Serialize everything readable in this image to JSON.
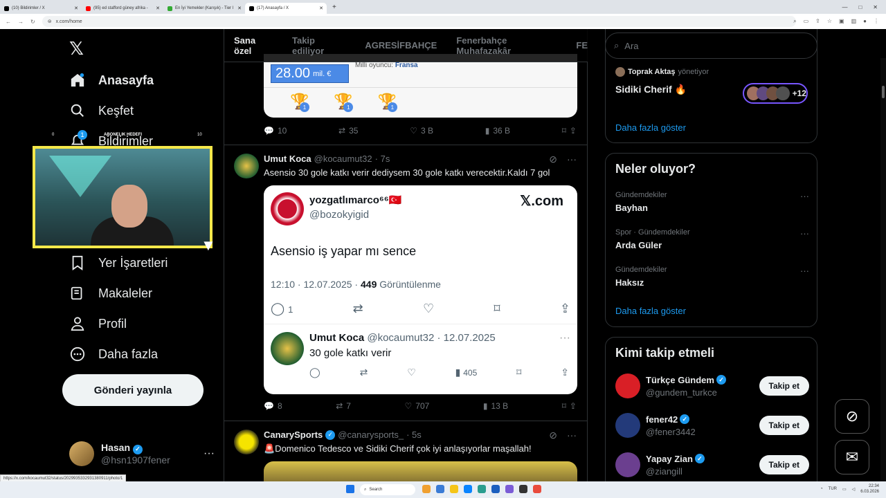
{
  "browser": {
    "tabs": [
      {
        "label": "(10) Bildirimler / X",
        "active": false
      },
      {
        "label": "(95) ed stafford güney afrika - ",
        "active": false
      },
      {
        "label": "En İyi Yemekler (Karışık) - Tier l",
        "active": false
      },
      {
        "label": "(17) Anasayfa / X",
        "active": true
      }
    ],
    "url": "x.com/home",
    "status_url": "https://x.com/kocaumut32/status/2029935332931380911/photo/1"
  },
  "nav": {
    "items": [
      {
        "label": "Anasayfa",
        "icon": "home-icon"
      },
      {
        "label": "Keşfet",
        "icon": "search-icon"
      },
      {
        "label": "Bildirimler",
        "icon": "bell-icon",
        "badge": "1"
      },
      {
        "label": "Yer İşaretleri",
        "icon": "bookmark-icon"
      },
      {
        "label": "Makaleler",
        "icon": "article-icon"
      },
      {
        "label": "Profil",
        "icon": "person-icon"
      },
      {
        "label": "Daha fazla",
        "icon": "more-circle-icon"
      }
    ],
    "post_button": "Gönderi yayınla",
    "account": {
      "name": "Hasan",
      "handle": "@hsn1907fener"
    }
  },
  "overlay": {
    "title": "ABONELIK HEDEFI",
    "left_num": "0",
    "right_num": "10"
  },
  "feed": {
    "tabs": [
      "Sana özel",
      "Takip ediliyor",
      "AGRESİFBAHÇE",
      "Fenerbahçe Muhafazakâr",
      "FE"
    ],
    "card_top": {
      "price": "28.00",
      "price_unit": "mil. €",
      "national_label": "Milli oyuncu:",
      "national_value": "Fransa",
      "trophy_counts": [
        "1",
        "1",
        "1"
      ]
    },
    "post0_actions": {
      "reply": "10",
      "repost": "35",
      "like": "3 B",
      "views": "36 B"
    },
    "post1": {
      "name": "Umut Koca",
      "handle": "@kocaumut32",
      "time": "· 7s",
      "text": "Asensio 30 gole katkı verir dediysem 30 gole katkı verecektir.Kaldı 7 gol",
      "embed": {
        "name": "yozgatlımarco⁶⁶🇹🇷",
        "handle": "@bozokyigid",
        "brand": "𝕏.com",
        "text": "Asensio iş yapar mı sence",
        "time": "12:10 · 12.07.2025 ·",
        "views_num": "449",
        "views_label": "Görüntülenme",
        "reply_count": "1",
        "reply": {
          "name": "Umut Koca",
          "handle": "@kocaumut32 · 12.07.2025",
          "text": "30 gole katkı verir",
          "views": "405"
        }
      },
      "actions": {
        "reply": "8",
        "repost": "7",
        "like": "707",
        "views": "13 B"
      }
    },
    "post2": {
      "name": "CanarySports",
      "handle": "@canarysports_",
      "time": "· 5s",
      "text": "🚨Domenico Tedesco ve Sidiki Cherif çok iyi anlaşıyorlar maşallah!"
    }
  },
  "right": {
    "search_placeholder": "Ara",
    "community": {
      "owner": "Toprak Aktaş",
      "owner_suffix": "yönetiyor",
      "name": "Sidiki Cherif 🔥",
      "members_extra": "+12",
      "more": "Daha fazla göster"
    },
    "trends_title": "Neler oluyor?",
    "trends": [
      {
        "meta": "Gündemdekiler",
        "title": "Bayhan"
      },
      {
        "meta": "Spor · Gündemdekiler",
        "title": "Arda Güler"
      },
      {
        "meta": "Gündemdekiler",
        "title": "Haksız"
      }
    ],
    "trends_more": "Daha fazla göster",
    "who_title": "Kimi takip etmeli",
    "who": [
      {
        "name": "Türkçe Gündem",
        "handle": "@gundem_turkce",
        "button": "Takip et",
        "color": "#d91f26"
      },
      {
        "name": "fener42",
        "handle": "@fener3442",
        "button": "Takip et",
        "color": "#233a7a"
      },
      {
        "name": "Yapay Zian",
        "handle": "@ziangill",
        "button": "Takip et",
        "color": "#6b3f8f"
      }
    ]
  },
  "taskbar": {
    "search": "Search",
    "lang": "TUR",
    "time": "22:34",
    "date": "6.03.2026"
  },
  "colors": {
    "accent": "#1d9bf0",
    "webcam_border": "#f5e84a"
  }
}
